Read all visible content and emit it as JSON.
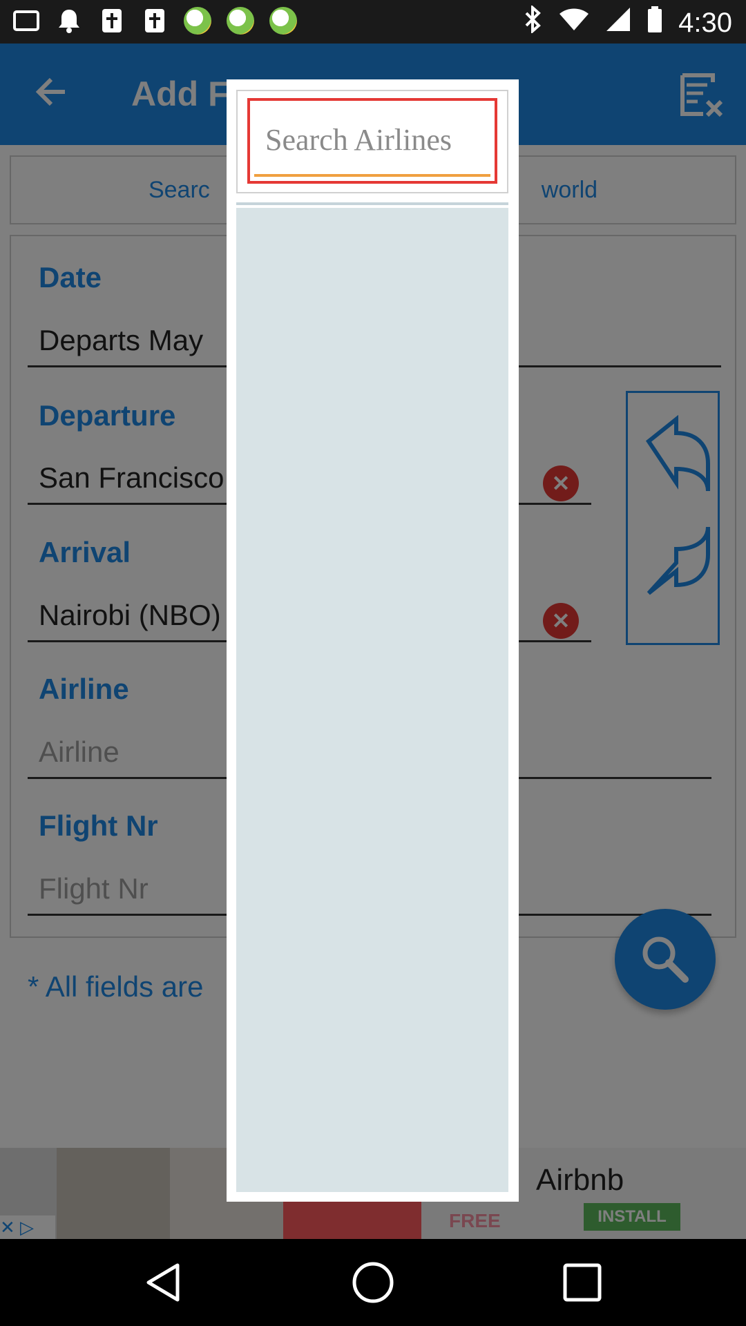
{
  "status_bar": {
    "time": "4:30"
  },
  "app_bar": {
    "title": "Add F"
  },
  "info_banner": {
    "left_text": "Searc",
    "right_text": "world"
  },
  "form": {
    "date": {
      "label": "Date",
      "value": "Departs May"
    },
    "departure": {
      "label": "Departure",
      "value": "San Francisco"
    },
    "arrival": {
      "label": "Arrival",
      "value": "Nairobi (NBO)"
    },
    "airline": {
      "label": "Airline",
      "placeholder": "Airline"
    },
    "flight_nr": {
      "label": "Flight Nr",
      "placeholder": "Flight Nr"
    },
    "note": "* All fields are"
  },
  "ad": {
    "brand": "Airbnb",
    "free": "FREE",
    "install": "INSTALL"
  },
  "dialog": {
    "search_placeholder": "Search Airlines",
    "search_value": ""
  },
  "colors": {
    "primary": "#1e88e5",
    "danger": "#e53935",
    "list_bg": "#d8e3e6"
  }
}
